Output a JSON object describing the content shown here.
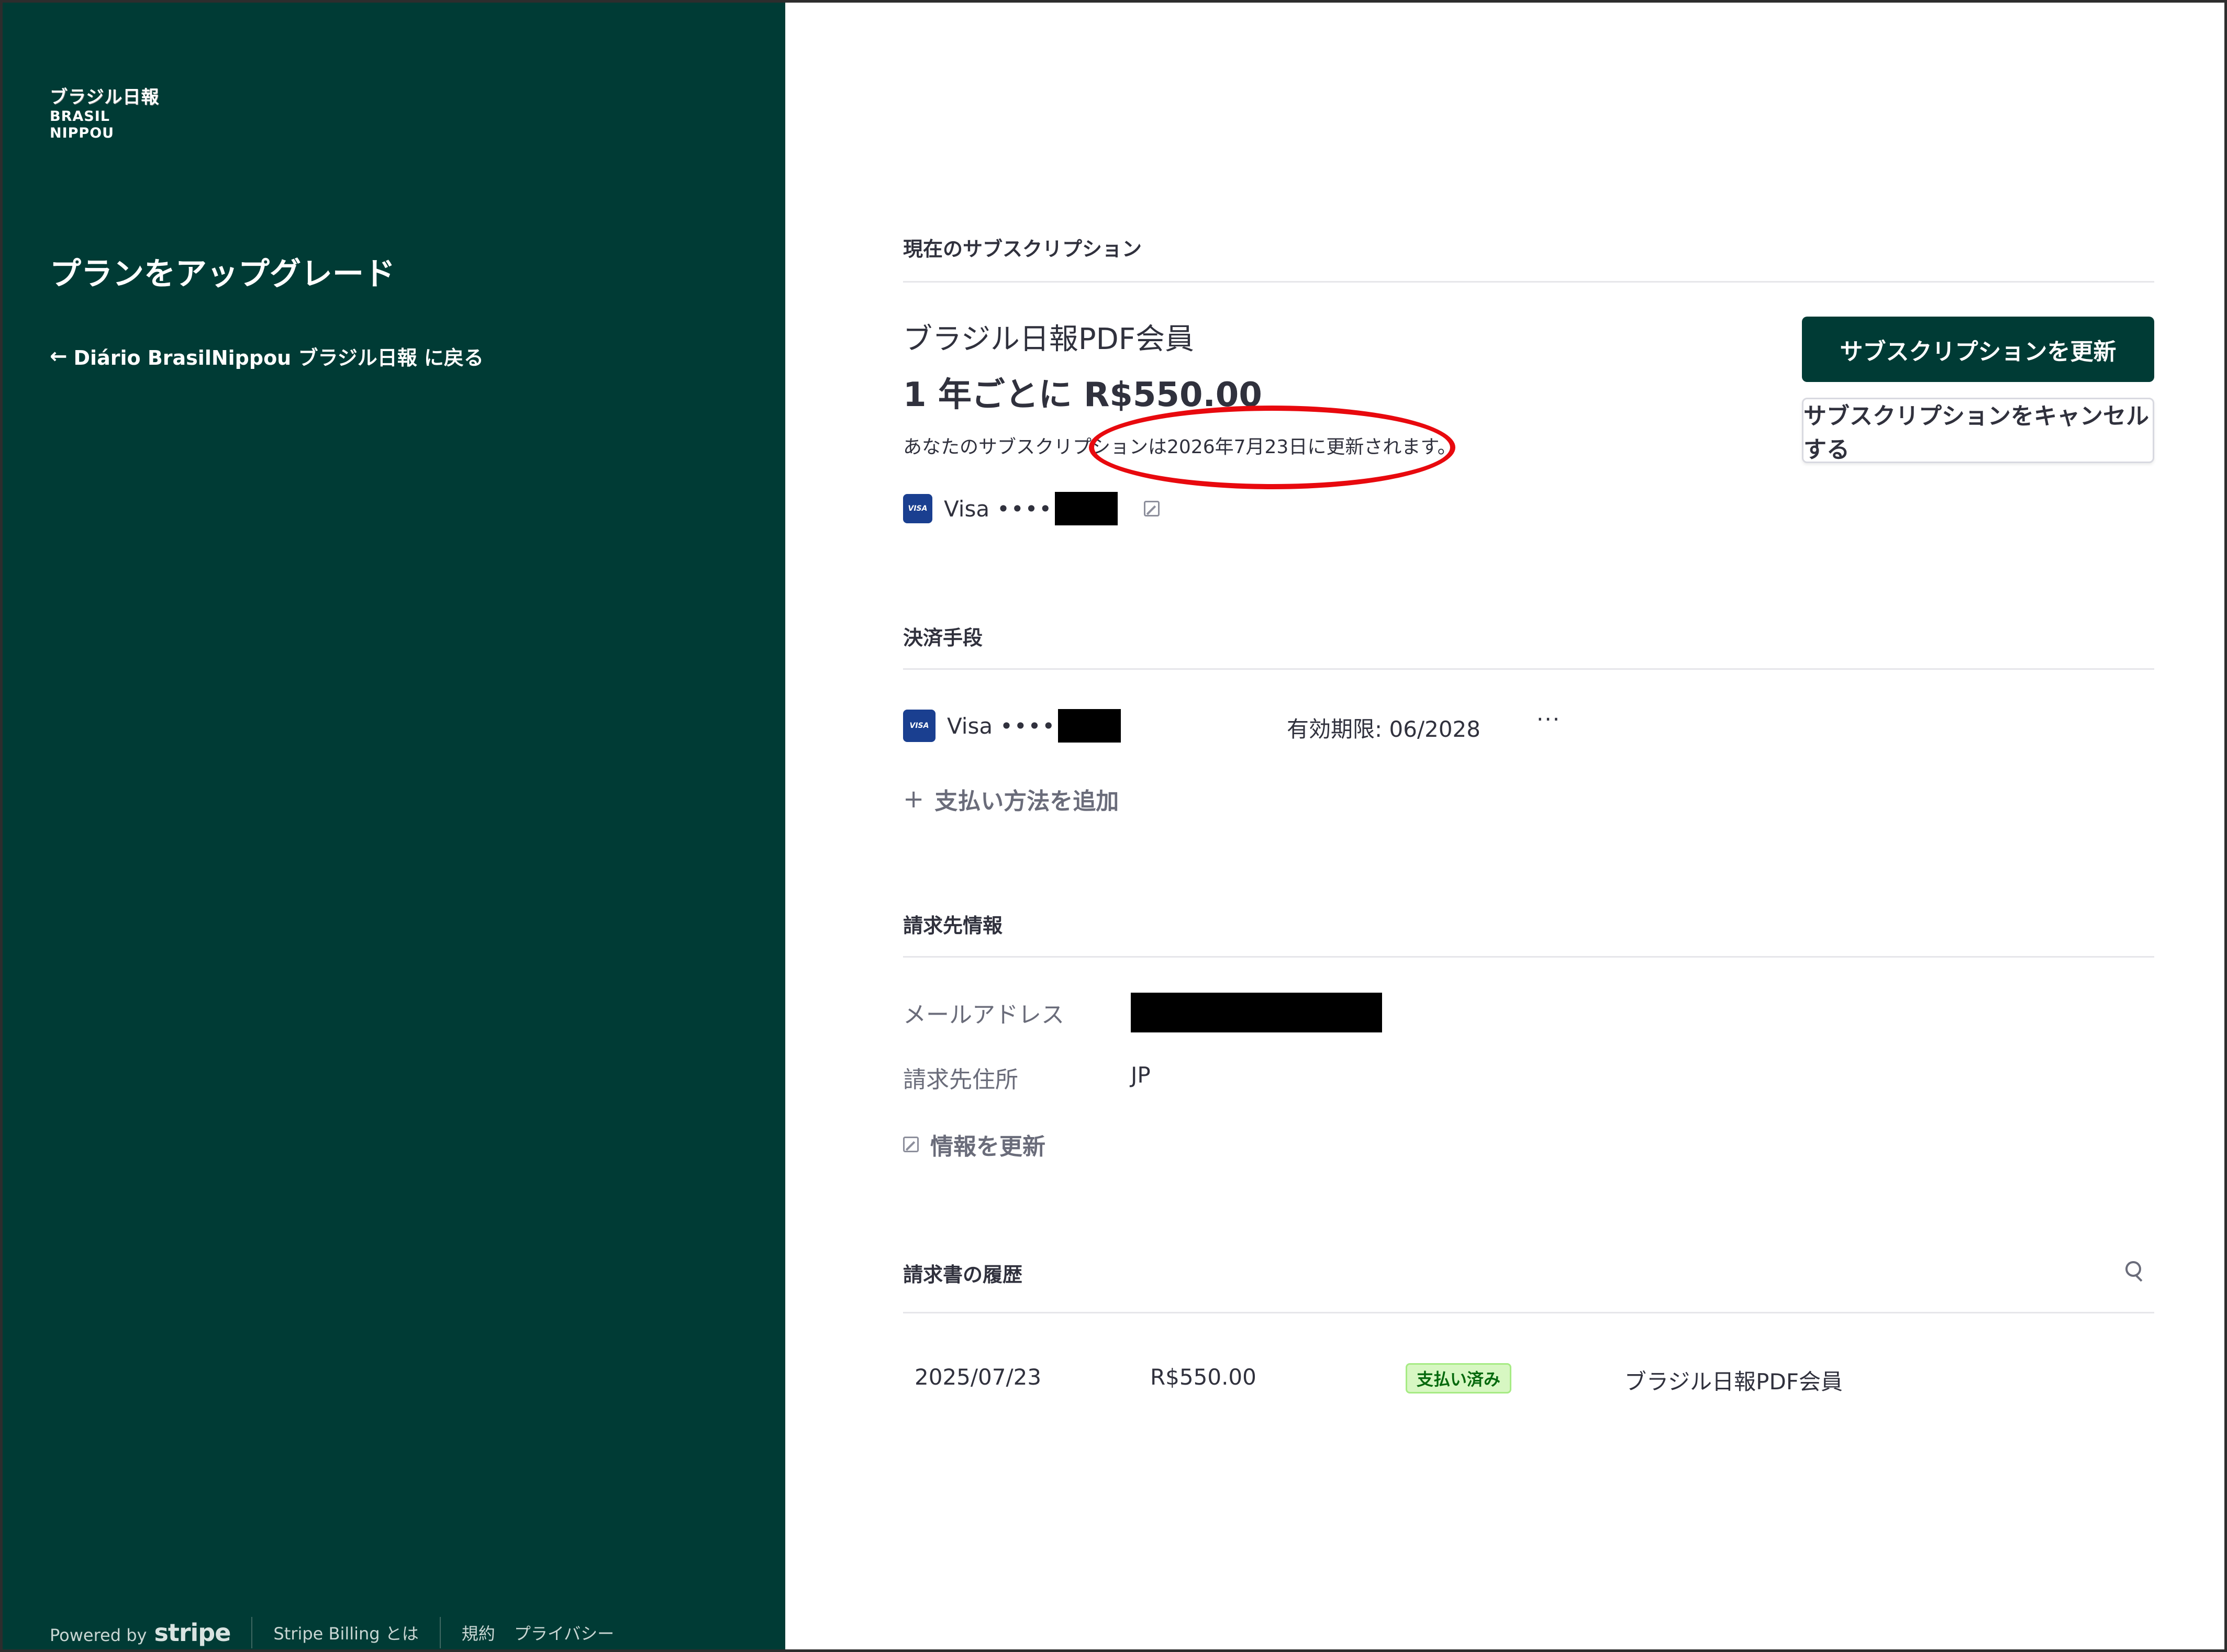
{
  "sidebar": {
    "logo_jp": "ブラジル日報",
    "logo_en": "BRASIL NIPPOU",
    "title": "プランをアップグレード",
    "back_link": "Diário BrasilNippou ブラジル日報 に戻る",
    "footer": {
      "powered_by": "Powered by",
      "stripe": "stripe",
      "billing_link": "Stripe Billing とは",
      "terms_link": "規約",
      "privacy_link": "プライバシー"
    }
  },
  "subscription": {
    "section_label": "現在のサブスクリプション",
    "plan_name": "ブラジル日報PDF会員",
    "price": "1 年ごとに R$550.00",
    "renewal_note": "あなたのサブスクリプションは2026年7月23日に更新されます。",
    "card_brand": "Visa",
    "card_dots": "••••",
    "update_button": "サブスクリプションを更新",
    "cancel_button": "サブスクリプションをキャンセルする"
  },
  "payment": {
    "section_label": "決済手段",
    "card_brand": "Visa",
    "card_dots": "••••",
    "expiry": "有効期限: 06/2028",
    "more": "···",
    "add_method": "支払い方法を追加"
  },
  "billing": {
    "section_label": "請求先情報",
    "email_label": "メールアドレス",
    "address_label": "請求先住所",
    "address_value": "JP",
    "update_info": "情報を更新"
  },
  "invoices": {
    "section_label": "請求書の履歴",
    "rows": [
      {
        "date": "2025/07/23",
        "amount": "R$550.00",
        "status": "支払い済み",
        "description": "ブラジル日報PDF会員"
      }
    ]
  },
  "icons": {
    "back": "arrow-left-icon",
    "card": "visa-card-icon",
    "edit": "edit-icon",
    "add": "plus-icon",
    "search": "search-icon"
  },
  "colors": {
    "sidebar_bg": "#003b35",
    "primary_button": "#003b35",
    "highlight_circle": "#e8090e",
    "paid_badge_bg": "#d7f7c2",
    "paid_badge_text": "#05690d"
  }
}
